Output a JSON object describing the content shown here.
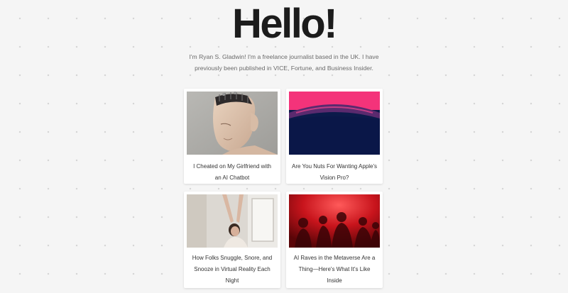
{
  "header": {
    "title": "Hello!"
  },
  "intro": {
    "text": "I'm Ryan S. Gladwin! I'm a freelance journalist based in the UK. I have previously been published in VICE, Fortune, and Business Insider."
  },
  "articles": [
    {
      "title": "I Cheated on My Girlfriend with an AI Chatbot",
      "image": "robot-face-image"
    },
    {
      "title": "Are You Nuts For Wanting Apple's Vision Pro?",
      "image": "vision-pro-headset-image"
    },
    {
      "title": "How Folks Snuggle, Snore, and Snooze in Virtual Reality Each Night",
      "image": "woman-stretching-image"
    },
    {
      "title": "AI Raves in the Metaverse Are a Thing—Here's What It's Like Inside",
      "image": "red-rave-crowd-image"
    }
  ],
  "colors": {
    "background": "#f5f5f5",
    "title": "#1c1c1c",
    "intro_text": "#6a6a6a",
    "rave_red": "#c8141c",
    "vision_pink": "#f4337a",
    "vision_navy": "#0b1a4a"
  }
}
